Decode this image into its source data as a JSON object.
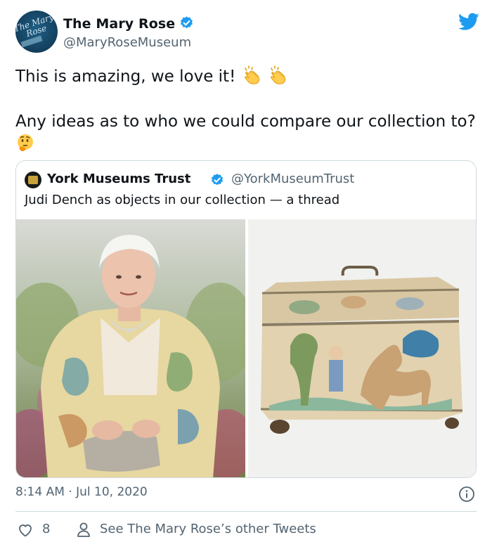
{
  "tweet": {
    "author": {
      "name": "The Mary Rose",
      "handle": "@MaryRoseMuseum",
      "avatar_text": "The Mary Rose"
    },
    "text_line1": "This is amazing, we love it!",
    "text_line2": "Any ideas as to who we could compare our collection to?",
    "emojis": [
      "clapping-hands",
      "clapping-hands",
      "thinking-face"
    ],
    "timestamp": "8:14 AM · Jul 10, 2020",
    "likes": "8",
    "see_other": "See The Mary Rose’s other Tweets"
  },
  "quoted": {
    "name": "York Museums Trust",
    "handle": "@YorkMuseumTrust",
    "text": "Judi Dench as objects in our collection — a thread",
    "images": [
      "photo-of-woman-in-floral-jacket",
      "embroidered-wooden-casket"
    ]
  },
  "colors": {
    "twitter_blue": "#1d9bf0",
    "text": "#0f1419",
    "secondary": "#536471",
    "border": "#cfd9de"
  }
}
